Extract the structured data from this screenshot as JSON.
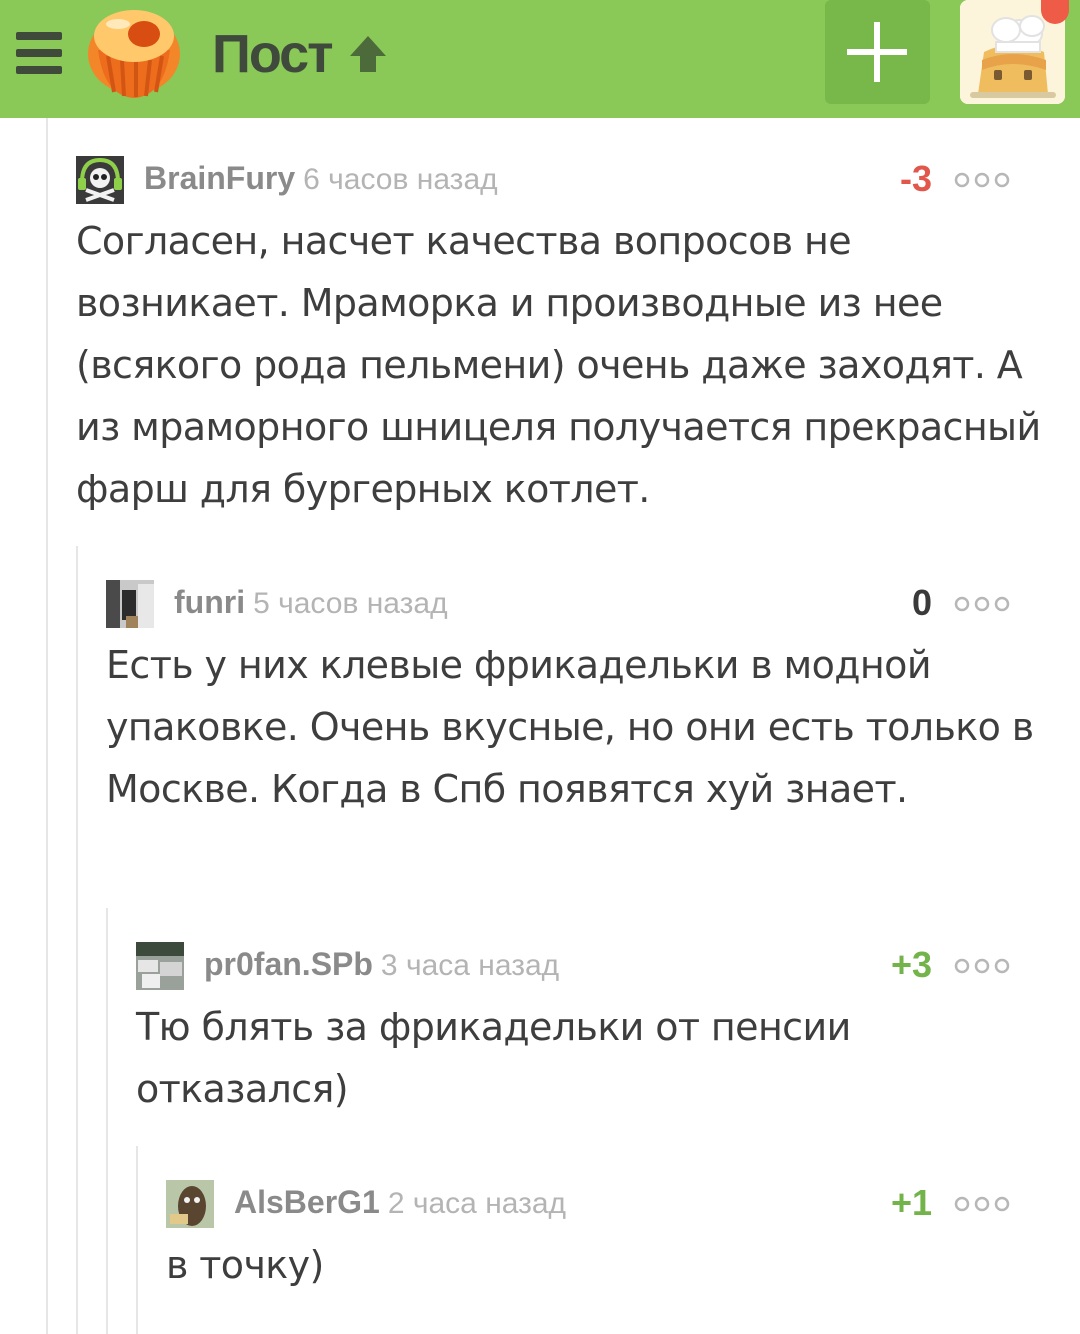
{
  "header": {
    "title": "Пост",
    "colors": {
      "bar": "#8ac858",
      "add_button": "#78b84b",
      "notification": "#ee5b46"
    },
    "icons": [
      "menu-icon",
      "pikabu-logo",
      "arrow-up-icon",
      "plus-icon",
      "user-avatar"
    ]
  },
  "comments": [
    {
      "author": "BrainFury",
      "time": "6 часов назад",
      "rating": "-3",
      "rating_color": "#e2574c",
      "text": "Согласен, насчет качества вопросов не возникает. Мраморка и производные из нее (всякого рода пельмени) очень даже заходят. А из мраморного шницеля получается прекрасный фарш для бургерных котлет."
    },
    {
      "author": "funri",
      "time": "5 часов назад",
      "rating": "0",
      "rating_color": "#3a3a3a",
      "text": "Есть у них клевые фрикадельки в модной упаковке. Очень вкусные, но они есть только в Москве. Когда в Спб появятся хуй знает."
    },
    {
      "author": "pr0fan.SPb",
      "time": "3 часа назад",
      "rating": "+3",
      "rating_color": "#72b34a",
      "text": "Тю блять за фрикадельки от пенсии отказался)"
    },
    {
      "author": "AlsBerG1",
      "time": "2 часа назад",
      "rating": "+1",
      "rating_color": "#72b34a",
      "text": "в точку)"
    }
  ]
}
